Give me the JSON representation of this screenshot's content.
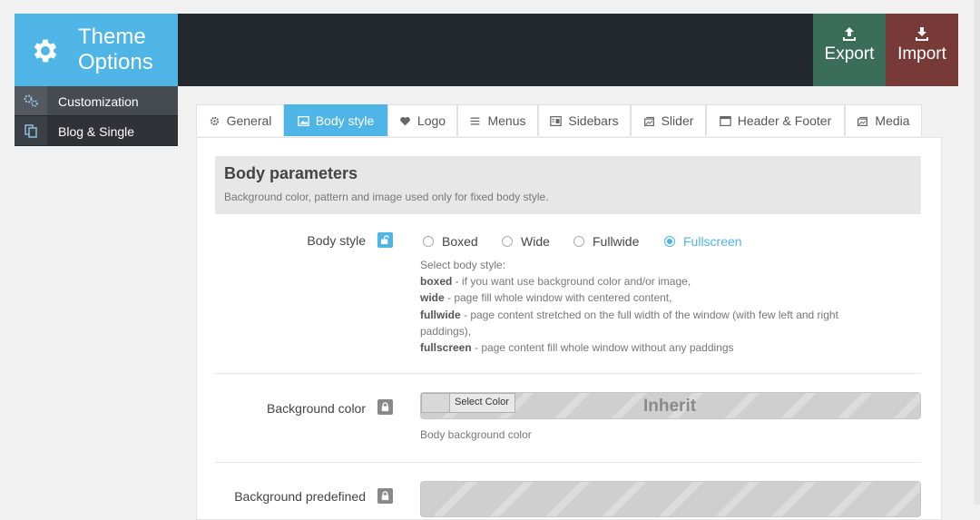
{
  "brand": {
    "title": "Theme Options",
    "icon": "gear-icon"
  },
  "header": {
    "export_label": "Export",
    "import_label": "Import"
  },
  "sidebar": {
    "items": [
      {
        "label": "Customization",
        "icon": "gears-icon"
      },
      {
        "label": "Blog & Single",
        "icon": "copy-icon"
      }
    ]
  },
  "tabs": [
    {
      "label": "General",
      "icon": "gear-icon"
    },
    {
      "label": "Body style",
      "icon": "image-icon"
    },
    {
      "label": "Logo",
      "icon": "heart-icon"
    },
    {
      "label": "Menus",
      "icon": "list-icon"
    },
    {
      "label": "Sidebars",
      "icon": "sidebar-icon"
    },
    {
      "label": "Slider",
      "icon": "slider-icon"
    },
    {
      "label": "Header & Footer",
      "icon": "window-icon"
    },
    {
      "label": "Media",
      "icon": "media-icon"
    }
  ],
  "section": {
    "title": "Body parameters",
    "description": "Background color, pattern and image used only for fixed body style."
  },
  "body_style": {
    "label": "Body style",
    "options": [
      "Boxed",
      "Wide",
      "Fullwide",
      "Fullscreen"
    ],
    "selected": "Fullscreen",
    "help_intro": "Select body style:",
    "help_lines": [
      {
        "term": "boxed",
        "text": " - if you want use background color and/or image,"
      },
      {
        "term": "wide",
        "text": " - page fill whole window with centered content,"
      },
      {
        "term": "fullwide",
        "text": " - page content stretched on the full width of the window (with few left and right paddings),"
      },
      {
        "term": "fullscreen",
        "text": " - page content fill whole window without any paddings"
      }
    ]
  },
  "background_color": {
    "label": "Background color",
    "button_label": "Select Color",
    "value": "Inherit",
    "help": "Body background color"
  },
  "background_predefined": {
    "label": "Background predefined"
  },
  "colors": {
    "accent": "#4eb5e6",
    "header_bg": "#23282d",
    "export_bg": "#3b6e58",
    "import_bg": "#773a37"
  }
}
